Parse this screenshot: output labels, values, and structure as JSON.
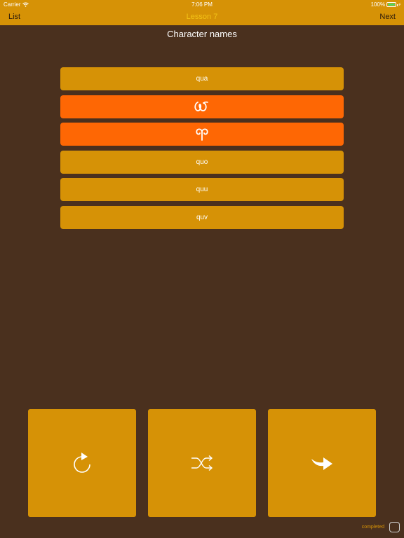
{
  "status_bar": {
    "carrier": "Carrier",
    "time": "7:06 PM",
    "battery": "100%"
  },
  "nav": {
    "left_label": "List",
    "title": "Lesson 7",
    "right_label": "Next"
  },
  "heading": "Character names",
  "options": [
    {
      "label": "qua",
      "state": "normal"
    },
    {
      "label": "",
      "state": "selected",
      "icon": "glyph-omega-script"
    },
    {
      "label": "",
      "state": "selected",
      "icon": "glyph-ram-horn"
    },
    {
      "label": "quo",
      "state": "normal"
    },
    {
      "label": "quu",
      "state": "normal"
    },
    {
      "label": "quv",
      "state": "normal"
    }
  ],
  "actions": [
    {
      "icon": "refresh-icon"
    },
    {
      "icon": "shuffle-icon"
    },
    {
      "icon": "forward-arrow-icon"
    }
  ],
  "footer": {
    "completed_label": "completed"
  },
  "colors": {
    "background": "#4a301e",
    "accent": "#d69206",
    "selected": "#fe6704",
    "title": "#f3c316"
  }
}
